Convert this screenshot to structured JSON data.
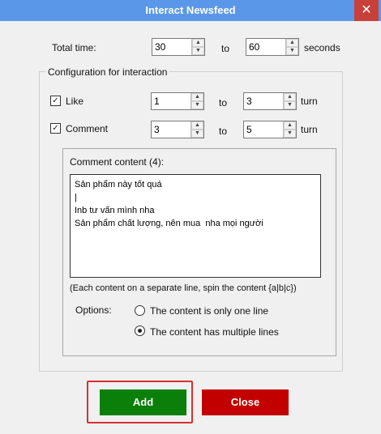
{
  "window": {
    "title": "Interact Newsfeed",
    "close_glyph": "✕"
  },
  "total_time": {
    "label": "Total time:",
    "from_value": "30",
    "to_label": "to",
    "to_value": "60",
    "unit": "seconds"
  },
  "config": {
    "group_title": "Configuration for interaction",
    "like": {
      "label": "Like",
      "checked": true,
      "from_value": "1",
      "to_label": "to",
      "to_value": "3",
      "unit": "turn"
    },
    "comment": {
      "label": "Comment",
      "checked": true,
      "from_value": "3",
      "to_label": "to",
      "to_value": "5",
      "unit": "turn"
    }
  },
  "comment_content": {
    "title": "Comment content (4):",
    "text": "Sản phẩm này tốt quá\n|\nInb tư vấn mình nha\nSản phẩm chất lượng, nên mua  nha mọi người",
    "hint": "(Each content on a separate line, spin the content {a|b|c})"
  },
  "options": {
    "label": "Options:",
    "one_line": {
      "label": "The content is only one line",
      "selected": false
    },
    "multi_line": {
      "label": "The content has multiple lines",
      "selected": true
    }
  },
  "buttons": {
    "add": "Add",
    "close": "Close"
  },
  "icons": {
    "checkbox_check": "✓",
    "spin_up": "▲",
    "spin_down": "▼"
  },
  "colors": {
    "titlebar": "#5b97e8",
    "add_button": "#0a7f0a",
    "close_button": "#c30000",
    "highlight": "#d93030"
  }
}
